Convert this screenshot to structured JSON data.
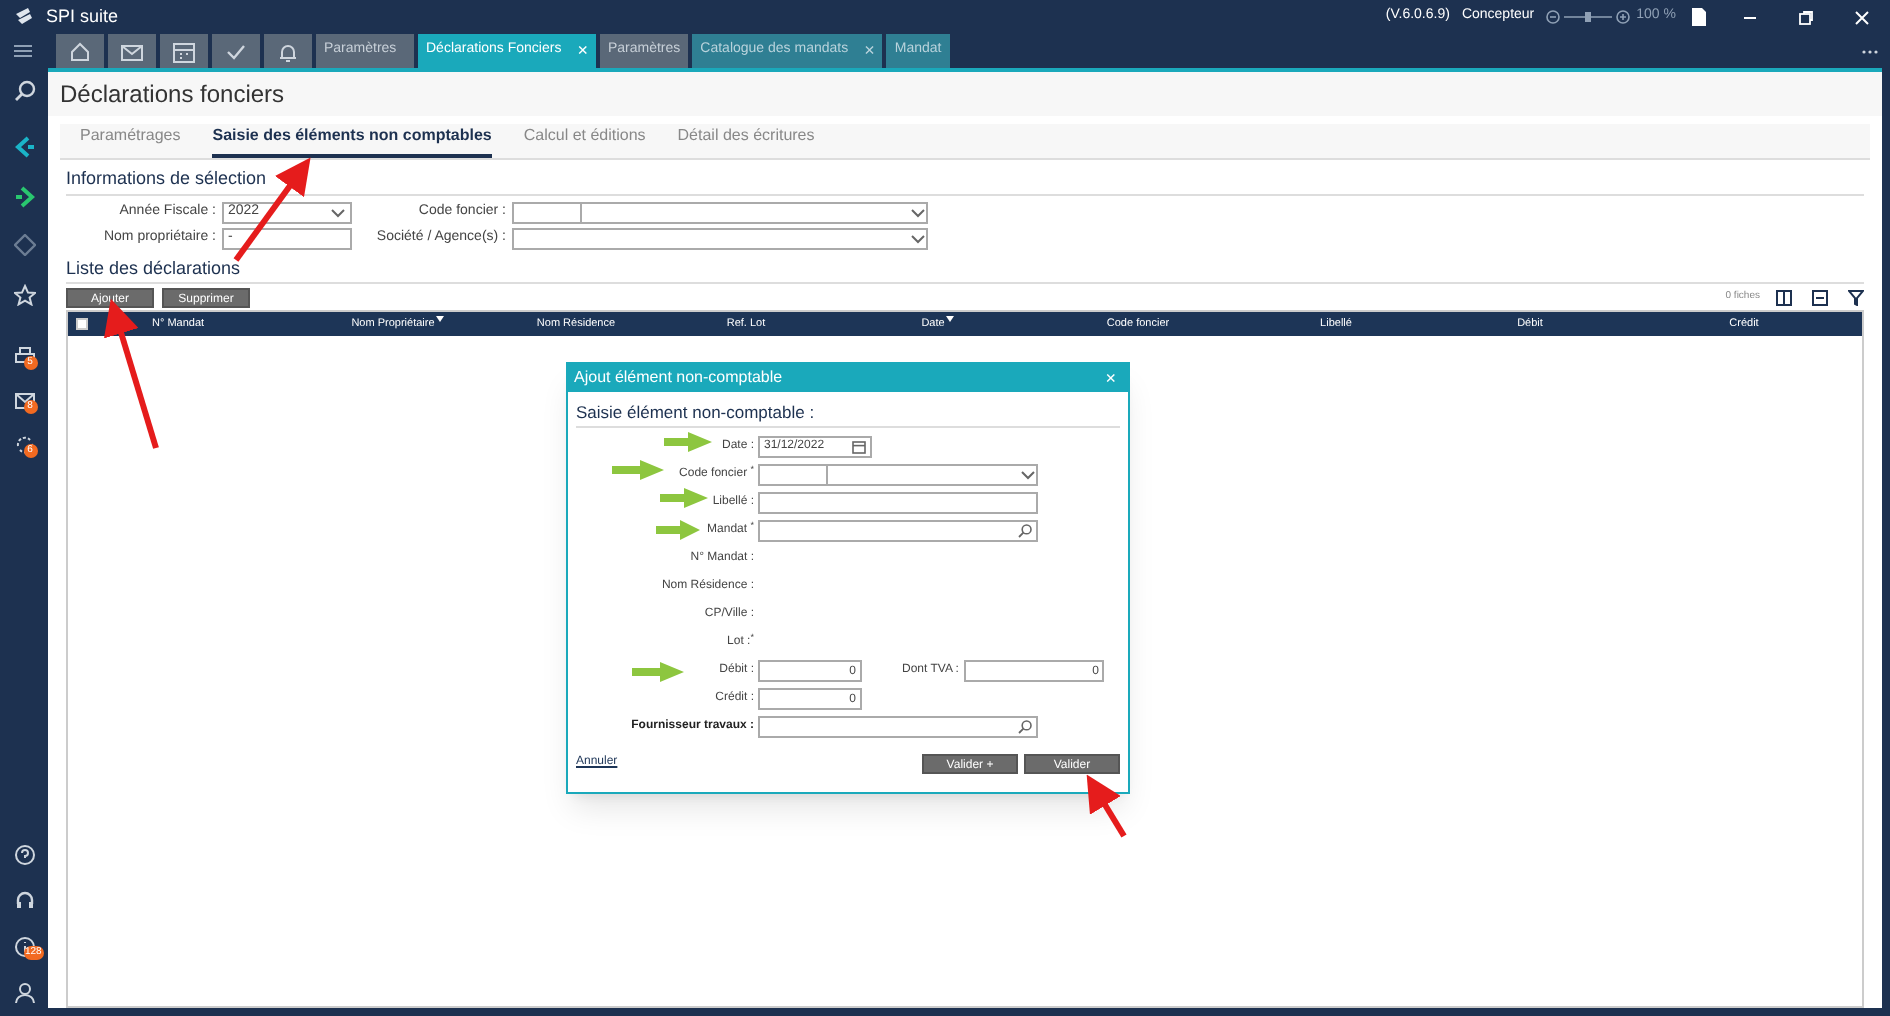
{
  "window": {
    "title": "SPI suite",
    "version": "(V.6.0.6.9)",
    "role": "Concepteur",
    "zoom": "100 %",
    "zoom_slider": {
      "level": 0.5
    }
  },
  "tabs": [
    {
      "label": "Paramètres",
      "selected": false
    },
    {
      "label": "Déclarations Fonciers",
      "close": "×",
      "selected": true
    },
    {
      "label": "Paramètres",
      "selected": false
    },
    {
      "label": "Catalogue des mandats",
      "close": "×",
      "selected": false
    },
    {
      "label": "Mandat",
      "selected": false
    }
  ],
  "sidebar": {
    "badges": [
      "5",
      "8",
      "6"
    ],
    "bottom_badge": "128"
  },
  "page": {
    "title": "Déclarations fonciers",
    "subtabs": [
      {
        "label": "Paramétrages",
        "selected": false
      },
      {
        "label": "Saisie des éléments non comptables",
        "selected": true
      },
      {
        "label": "Calcul et éditions",
        "selected": false
      },
      {
        "label": "Détail des écritures",
        "selected": false
      }
    ],
    "selection": {
      "title": "Informations de sélection",
      "annee_label": "Année Fiscale :",
      "annee_value": "2022",
      "code_label": "Code foncier :",
      "owner_label": "Nom propriétaire :",
      "owner_value": "-",
      "societe_label": "Société / Agence(s) :"
    },
    "list": {
      "title": "Liste des déclarations",
      "buttons": [
        "Ajouter",
        "Supprimer"
      ],
      "count": "0 fiches",
      "select_all_checked": false,
      "columns": [
        {
          "label": "N° Mandat",
          "filter": false
        },
        {
          "label": "Nom Propriétaire",
          "filter": true
        },
        {
          "label": "Nom Résidence",
          "filter": false
        },
        {
          "label": "Ref. Lot",
          "filter": false
        },
        {
          "label": "Date",
          "filter": true
        },
        {
          "label": "Code foncier",
          "filter": false
        },
        {
          "label": "Libellé",
          "filter": false
        },
        {
          "label": "Débit",
          "filter": false
        },
        {
          "label": "Crédit",
          "filter": false
        }
      ]
    }
  },
  "dialog": {
    "title": "Ajout élément non-comptable",
    "close": "×",
    "heading": "Saisie élément non-comptable :",
    "fields": [
      {
        "kind": "date",
        "label": "Date :",
        "value": "31/12/2022"
      },
      {
        "kind": "combo",
        "label": "Code foncier $^{*}$"
      },
      {
        "kind": "text",
        "label": "Libellé :"
      },
      {
        "kind": "search",
        "label": "Mandat $^{*}$"
      },
      {
        "kind": "static",
        "label": "N° Mandat :"
      },
      {
        "kind": "static",
        "label": "Nom Résidence :"
      },
      {
        "kind": "static",
        "label": "CP/Ville :"
      },
      {
        "kind": "static",
        "label": "Lot :$^{*}$"
      },
      {
        "kind": "pair",
        "label": "Débit :",
        "value": "0",
        "label2": "Dont TVA :",
        "value2": "0"
      },
      {
        "kind": "number",
        "label": "Crédit :",
        "value": "0"
      },
      {
        "kind": "search",
        "label": "Fournisseur travaux :",
        "bold": true
      }
    ],
    "cancel": "Annuler",
    "buttons": [
      "Valider +",
      "Valider"
    ]
  }
}
